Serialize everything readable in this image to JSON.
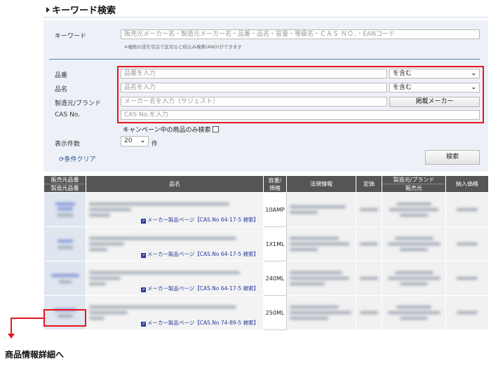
{
  "title": "キーワード検索",
  "search": {
    "keyword_label": "キーワード",
    "keyword_placeholder": "販売元メーカー名・製造元メーカー名・品番・品名・容量・等級名・ＣＡＳ ＮＯ．・EANコード",
    "keyword_note": "※複数の語を空白で区切ると絞込み検索(AND)ができます",
    "part_no_label": "品番",
    "part_no_placeholder": "品番を入力",
    "part_no_match": "を含む",
    "name_label": "品名",
    "name_placeholder": "品名を入力",
    "name_match": "を含む",
    "brand_label": "製造元/ブランド",
    "brand_placeholder": "メーカー名を入力（サジェスト）",
    "brand_button": "掲載メーカー",
    "cas_label": "CAS No.",
    "cas_placeholder": "CAS No.を入力",
    "campaign_label": "キャンペーン中の商品のみ検索",
    "count_label": "表示件数",
    "count_value": "20",
    "count_unit": "件",
    "clear_label": "条件クリア",
    "search_button": "検索"
  },
  "table": {
    "headers": {
      "seller_no": "販売元品番",
      "maker_no": "製造元品番",
      "name": "品名",
      "capacity_1": "容量/",
      "capacity_2": "規格",
      "law": "法規情報",
      "price": "定価",
      "maker_brand": "製造元/ブランド",
      "seller": "販売元",
      "delivery": "納入価格"
    },
    "rows": [
      {
        "link": "メーカー製品ページ【CAS.No 64-17-5 検索】",
        "capacity": "10AMP"
      },
      {
        "link": "メーカー製品ページ【CAS.No 64-17-5 検索】",
        "capacity": "1X1ML"
      },
      {
        "link": "メーカー製品ページ【CAS.No 64-17-5 検索】",
        "capacity": "240ML"
      },
      {
        "link": "メーカー製品ページ【CAS.No 74-89-5 検索】",
        "capacity": "250ML"
      }
    ]
  },
  "annotation": "商品情報詳細へ",
  "colors": {
    "highlight": "#e8141e",
    "header_bg": "#555555",
    "panel_bg": "#edf1f7",
    "link": "#2a3a9e"
  }
}
